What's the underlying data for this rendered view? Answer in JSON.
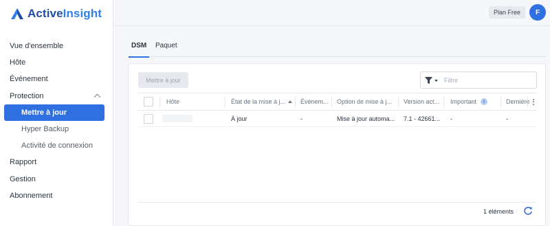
{
  "brand": {
    "part1": "Active",
    "part2": "Insight",
    "accent": "#2f6fe0"
  },
  "topbar": {
    "plan": "Plan Free",
    "avatar_initial": "F"
  },
  "sidebar": {
    "items": [
      {
        "label": "Vue d'ensemble"
      },
      {
        "label": "Hôte"
      },
      {
        "label": "Événement"
      },
      {
        "label": "Protection",
        "expanded": true
      },
      {
        "label": "Mettre à jour",
        "active": true
      },
      {
        "label": "Hyper Backup"
      },
      {
        "label": "Activité de connexion"
      },
      {
        "label": "Rapport"
      },
      {
        "label": "Gestion"
      },
      {
        "label": "Abonnement"
      }
    ]
  },
  "tabs": [
    {
      "label": "DSM",
      "active": true
    },
    {
      "label": "Paquet"
    }
  ],
  "toolbar": {
    "update_button": "Mettre à jour",
    "filter_placeholder": "Filtre"
  },
  "table": {
    "columns": [
      "Hôte",
      "État de la mise à j...",
      "Événem...",
      "Option de mise à j...",
      "Version act...",
      "Important",
      "Dernière"
    ],
    "rows": [
      {
        "host": "",
        "status": "À jour",
        "event": "-",
        "option": "Mise à jour automa...",
        "version": "7.1 - 42661...",
        "important": "-",
        "last": "-"
      }
    ]
  },
  "footer": {
    "count": "1 éléments"
  }
}
